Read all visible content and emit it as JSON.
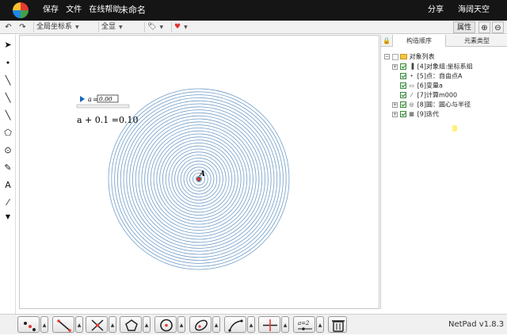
{
  "app": {
    "menu": [
      "保存",
      "文件",
      "在线帮助"
    ],
    "doc_title": "未命名",
    "share": "分享",
    "user": "海阔天空"
  },
  "toolbar": {
    "coord_select": "全局坐标系",
    "view_select": "全显",
    "property_label": "属性"
  },
  "panel": {
    "tabs": [
      "构造顺序",
      "元素类型"
    ],
    "root": "对象列表",
    "items": [
      {
        "label": "[4]对象组:坐标系组",
        "expandable": true,
        "icon": "group-icon"
      },
      {
        "label": "[5]点：自由点A",
        "expandable": false,
        "icon": "point-icon"
      },
      {
        "label": "[6]变量a",
        "expandable": false,
        "icon": "variable-icon"
      },
      {
        "label": "[7]计算m000",
        "expandable": false,
        "icon": "calc-icon"
      },
      {
        "label": "[8]圆：圆心与半径",
        "expandable": true,
        "icon": "circle-icon"
      },
      {
        "label": "[9]迭代",
        "expandable": true,
        "icon": "iteration-icon"
      }
    ]
  },
  "canvas": {
    "slider_var": "a",
    "slider_value": "0.00",
    "expression": "a + 0.1 =0.10",
    "point_label": "A",
    "circle_color": "#6f9cc8",
    "ring_count": 30
  },
  "version": "NetPad v1.8.3"
}
